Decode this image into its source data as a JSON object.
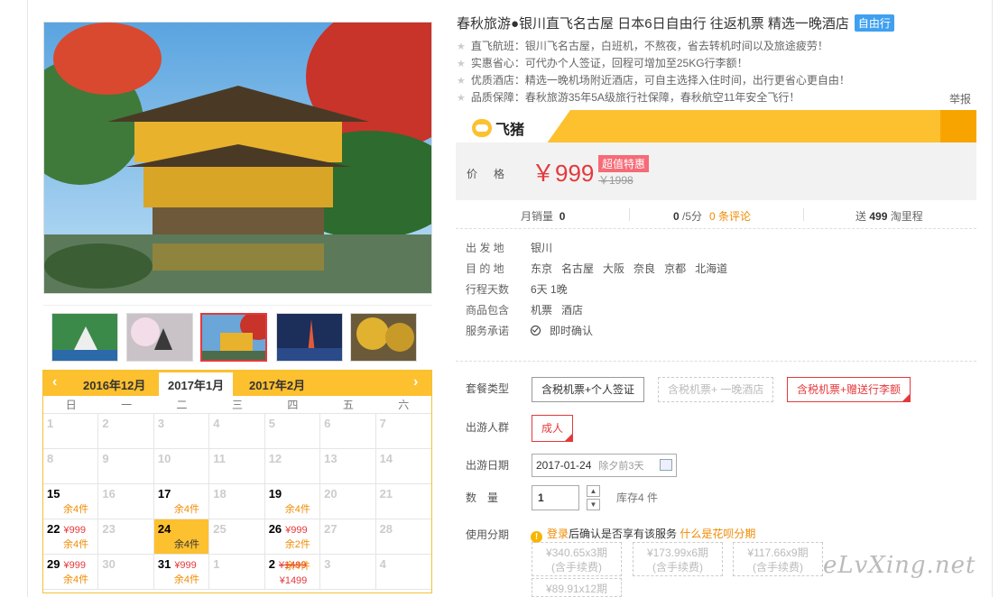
{
  "product": {
    "title": "春秋旅游●银川直飞名古屋 日本6日自由行 往返机票 精选一晚酒店",
    "tag": "自由行",
    "features": [
      "直飞航班：银川飞名古屋，白班机，不熬夜，省去转机时间以及旅途疲劳！",
      "实惠省心：可代办个人签证，回程可增加至25KG行李额！",
      "优质酒店：精选一晚机场附近酒店，可自主选择入住时间，出行更省心更自由！",
      "品质保障：春秋旅游35年5A级旅行社保障，春秋航空11年安全飞行！"
    ],
    "report": "举报"
  },
  "brand": {
    "name": "飞猪",
    "accent": "#fdc02f"
  },
  "price": {
    "label": "价格",
    "value": "￥999",
    "badge": "超值特惠",
    "original": "￥1998"
  },
  "stats": {
    "monthly_label": "月销量",
    "monthly_value": "0",
    "rating_value": "0",
    "rating_unit": "/5分",
    "reviews": "0 条评论",
    "points_prefix": "送",
    "points_value": "499",
    "points_suffix": "淘里程"
  },
  "info": [
    {
      "label": "出 发 地",
      "values": [
        "银川"
      ]
    },
    {
      "label": "目 的 地",
      "values": [
        "东京",
        "名古屋",
        "大阪",
        "奈良",
        "京都",
        "北海道"
      ]
    },
    {
      "label": "行程天数",
      "values": [
        "6天 1晚"
      ]
    },
    {
      "label": "商品包含",
      "values": [
        "机票",
        "酒店"
      ]
    },
    {
      "label": "服务承诺",
      "values": [
        "即时确认"
      ]
    }
  ],
  "options": {
    "package_label": "套餐类型",
    "packages": [
      "含税机票+个人签证",
      "含税机票+ 一晚酒店",
      "含税机票+赠送行李额"
    ],
    "traveler_label": "出游人群",
    "traveler": "成人",
    "date_label": "出游日期",
    "date_value": "2017-01-24",
    "date_hint": "除夕前3天",
    "qty_label": "数　量",
    "qty_value": "1",
    "stock": "库存4 件",
    "installment_label": "使用分期",
    "installment_login": "登录",
    "installment_text": "后确认是否享有该服务",
    "installment_link": "什么是花呗分期",
    "plans": [
      {
        "amount": "¥340.65",
        "periods": "x3期",
        "note": "(含手续费)"
      },
      {
        "amount": "¥173.99",
        "periods": "x6期",
        "note": "(含手续费)"
      },
      {
        "amount": "¥117.66",
        "periods": "x9期",
        "note": "(含手续费)"
      },
      {
        "amount": "¥89.91",
        "periods": "x12期",
        "note": ""
      }
    ]
  },
  "calendar": {
    "months": [
      "2016年12月",
      "2017年1月",
      "2017年2月"
    ],
    "weekdays": [
      "日",
      "一",
      "二",
      "三",
      "四",
      "五",
      "六"
    ],
    "cells": [
      {
        "d": "1"
      },
      {
        "d": "2"
      },
      {
        "d": "3"
      },
      {
        "d": "4"
      },
      {
        "d": "5"
      },
      {
        "d": "6"
      },
      {
        "d": "7"
      },
      {
        "d": "8"
      },
      {
        "d": "9"
      },
      {
        "d": "10"
      },
      {
        "d": "11"
      },
      {
        "d": "12"
      },
      {
        "d": "13"
      },
      {
        "d": "14"
      },
      {
        "d": "15",
        "a": true,
        "s": "余4件"
      },
      {
        "d": "16"
      },
      {
        "d": "17",
        "a": true,
        "s": "余4件"
      },
      {
        "d": "18"
      },
      {
        "d": "19",
        "a": true,
        "s": "余4件"
      },
      {
        "d": "20"
      },
      {
        "d": "21"
      },
      {
        "d": "22",
        "a": true,
        "p": "¥999",
        "s": "余4件"
      },
      {
        "d": "23"
      },
      {
        "d": "24",
        "a": true,
        "sel": true,
        "s": "余4件"
      },
      {
        "d": "25"
      },
      {
        "d": "26",
        "a": true,
        "p": "¥999",
        "s": "余2件"
      },
      {
        "d": "27"
      },
      {
        "d": "28"
      },
      {
        "d": "29",
        "a": true,
        "p": "¥999",
        "s": "余4件"
      },
      {
        "d": "30"
      },
      {
        "d": "31",
        "a": true,
        "p": "¥999",
        "s": "余4件"
      },
      {
        "d": "1"
      },
      {
        "d": "2",
        "a": true,
        "p": "¥1499",
        "strike": true,
        "s": "余4件",
        "p2": "¥1499"
      },
      {
        "d": "3"
      },
      {
        "d": "4"
      }
    ]
  },
  "watermark": "eLvXing.net"
}
